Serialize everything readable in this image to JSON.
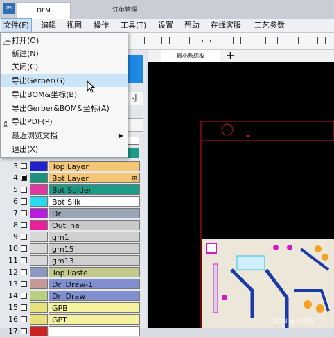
{
  "window": {
    "tab_active": "DFM",
    "tab_inactive": "订单管理",
    "logo_text": "DFM"
  },
  "menubar": [
    "文件(F)",
    "编辑",
    "视图",
    "操作",
    "工具(T)",
    "设置",
    "帮助",
    "在线客服",
    "工艺参数"
  ],
  "doc_tab": "最小系统板",
  "panel": {
    "button_fragment": "寸"
  },
  "file_menu": [
    {
      "label": "打开(O)",
      "icon": "folder-open-icon"
    },
    {
      "label": "新建(N)"
    },
    {
      "label": "关闭(C)"
    },
    {
      "label": "导出Gerber(G)",
      "highlighted": true
    },
    {
      "label": "导出BOM&坐标(B)"
    },
    {
      "label": "导出Gerber&BOM&坐标(A)"
    },
    {
      "label": "导出PDF(P)",
      "icon": "printer-icon"
    },
    {
      "label": "最近浏览文档",
      "submenu": true
    },
    {
      "label": "退出(X)"
    }
  ],
  "layers": [
    {
      "num": "3",
      "name": "Top Layer",
      "color": "#2222cc",
      "bg": "#f4c675",
      "checked": false
    },
    {
      "num": "4",
      "name": "Bot Layer",
      "color": "#1f8f80",
      "bg": "#f4c675",
      "checked": true,
      "expandable": true
    },
    {
      "num": "5",
      "name": "Bot Solder",
      "color": "#e03aa0",
      "bg": "#1e9a87",
      "checked": false
    },
    {
      "num": "6",
      "name": "Bot Silk",
      "color": "#2ad8f0",
      "bg": "#ffffff",
      "checked": false
    },
    {
      "num": "7",
      "name": "Drl",
      "color": "#b71fe0",
      "bg": "#9aa6b5",
      "checked": false
    },
    {
      "num": "8",
      "name": "Outline",
      "color": "#e8209a",
      "bg": "#c9c9c9",
      "checked": false
    },
    {
      "num": "9",
      "name": "gm1",
      "color": "#d8d8d8",
      "bg": "#cfcfcf",
      "checked": false
    },
    {
      "num": "10",
      "name": "gm15",
      "color": "#d8d8d8",
      "bg": "#cfcfcf",
      "checked": false
    },
    {
      "num": "11",
      "name": "gm13",
      "color": "#d8d8d8",
      "bg": "#cfcfcf",
      "checked": false
    },
    {
      "num": "12",
      "name": "Top Paste",
      "color": "#8a9bbf",
      "bg": "#c2c98a",
      "checked": false
    },
    {
      "num": "13",
      "name": "Drl Draw-1",
      "color": "#c49a96",
      "bg": "#7f8fd0",
      "checked": false
    },
    {
      "num": "14",
      "name": "Drl Draw",
      "color": "#b7d080",
      "bg": "#7f8fd0",
      "checked": false
    },
    {
      "num": "15",
      "name": "GPB",
      "color": "#e8e07a",
      "bg": "#f6f3a0",
      "checked": false
    },
    {
      "num": "16",
      "name": "GPT",
      "color": "#e8e07a",
      "bg": "#f6f3a0",
      "checked": false
    },
    {
      "num": "17",
      "name": "",
      "color": "#cc2222",
      "bg": "#ffffff",
      "checked": false
    }
  ],
  "watermark": "CSDN @大智兄"
}
